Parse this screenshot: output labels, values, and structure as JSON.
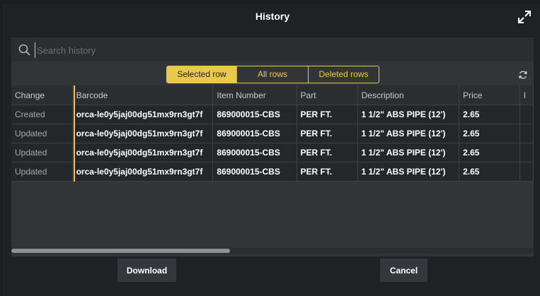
{
  "dialog": {
    "title": "History"
  },
  "search": {
    "placeholder": "Search history",
    "value": ""
  },
  "filter": {
    "options": [
      "Selected row",
      "All rows",
      "Deleted rows"
    ],
    "selected": "Selected row"
  },
  "table": {
    "columns": [
      "Change",
      "Barcode",
      "Item Number",
      "Part",
      "Description",
      "Price",
      "I"
    ],
    "rows": [
      {
        "change": "Created",
        "barcode": "orca-le0y5jaj00dg51mx9rn3gt7f",
        "item_number": "869000015-CBS",
        "part": "PER FT.",
        "description": "1 1/2\" ABS PIPE (12')",
        "price": "2.65"
      },
      {
        "change": "Updated",
        "barcode": "orca-le0y5jaj00dg51mx9rn3gt7f",
        "item_number": "869000015-CBS",
        "part": "PER FT.",
        "description": "1 1/2\" ABS PIPE (12')",
        "price": "2.65"
      },
      {
        "change": "Updated",
        "barcode": "orca-le0y5jaj00dg51mx9rn3gt7f",
        "item_number": "869000015-CBS",
        "part": "PER FT.",
        "description": "1 1/2\" ABS PIPE (12')",
        "price": "2.65"
      },
      {
        "change": "Updated",
        "barcode": "orca-le0y5jaj00dg51mx9rn3gt7f",
        "item_number": "869000015-CBS",
        "part": "PER FT.",
        "description": "1 1/2\" ABS PIPE (12')",
        "price": "2.65"
      }
    ]
  },
  "footer": {
    "download_label": "Download",
    "cancel_label": "Cancel"
  },
  "colors": {
    "accent": "#e9c94c",
    "background": "#1f2124",
    "panel": "#323538"
  },
  "icons": {
    "expand": "expand-icon",
    "search": "search-icon",
    "refresh": "refresh-icon"
  }
}
